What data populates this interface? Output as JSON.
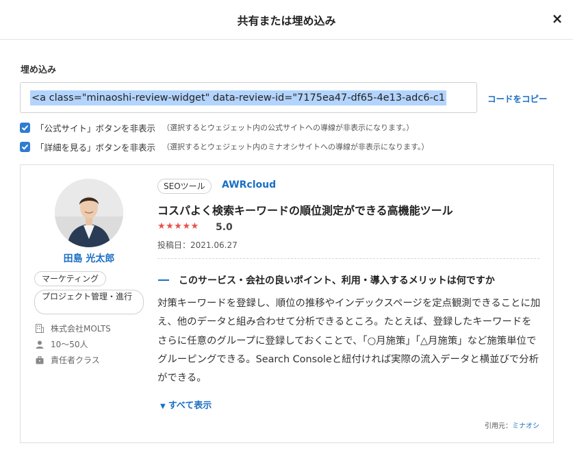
{
  "modal": {
    "title": "共有または埋め込み",
    "close_label": "×"
  },
  "embed": {
    "label": "埋め込み",
    "code": "<a class=\"minaoshi-review-widget\" data-review-id=\"7175ea47-df65-4e13-adc6-c1",
    "copy_label": "コードをコピー"
  },
  "options": [
    {
      "label": "「公式サイト」ボタンを非表示",
      "note": "（選択するとウェジェット内の公式サイトへの導線が非表示になります。）",
      "checked": true
    },
    {
      "label": "「詳細を見る」ボタンを非表示",
      "note": "（選択するとウェジェット内のミナオシサイトへの導線が非表示になります。）",
      "checked": true
    }
  ],
  "reviewer": {
    "name": "田島 光太郎",
    "tags": [
      "マーケティング",
      "プロジェクト管理・進行"
    ],
    "company_icon": "building-icon",
    "company": "株式会社MOLTS",
    "size_icon": "person-icon",
    "size": "10〜50人",
    "role_icon": "briefcase-icon",
    "role": "責任者クラス"
  },
  "review": {
    "category": "SEOツール",
    "service": "AWRcloud",
    "title": "コスパよく検索キーワードの順位測定ができる高機能ツール",
    "stars": "★★★★★",
    "rating": 5.0,
    "score": "5.0",
    "date": "投稿日：2021.06.27",
    "question": "このサービス・会社の良いポイント、利用・導入するメリットは何ですか",
    "answer": "対策キーワードを登録し、順位の推移やインデックスページを定点観測できることに加え、他のデータと組み合わせて分析できるところ。たとえば、登録したキーワードをさらに任意のグループに登録しておくことで、「○月施策」「△月施策」など施策単位でグルーピングできる。Search Consoleと紐付ければ実際の流入データと横並びで分析ができる。",
    "show_all": "すべて表示",
    "source_prefix": "引用元：",
    "source_name": "ミナオシ"
  },
  "colors": {
    "accent": "#1a6fc4",
    "star": "#e5534b",
    "checkbox": "#2f7bd0",
    "selection": "#b3d4fc"
  }
}
